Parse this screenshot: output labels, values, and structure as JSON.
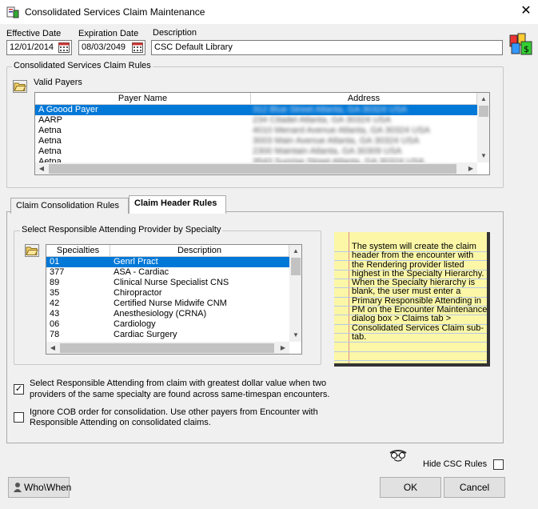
{
  "window": {
    "title": "Consolidated Services Claim Maintenance",
    "close_glyph": "✕"
  },
  "header": {
    "effective_date_label": "Effective Date",
    "effective_date": "12/01/2014",
    "expiration_date_label": "Expiration Date",
    "expiration_date": "08/03/2049",
    "description_label": "Description",
    "description": "CSC Default Library"
  },
  "rules_group": {
    "title": "Consolidated Services Claim Rules",
    "valid_payers_label": "Valid Payers",
    "columns": [
      "Payer Name",
      "Address"
    ],
    "rows": [
      [
        "A Goood Payer",
        "312 Blue Street Atlanta, GA 30324 USA"
      ],
      [
        "AARP",
        "234 Citadel Atlanta, GA 30324 USA"
      ],
      [
        "Aetna",
        "4010 Menard Avenue Atlanta, GA 30324 USA"
      ],
      [
        "Aetna",
        "3003 Main Avenue Atlanta, GA 30324 USA"
      ],
      [
        "Aetna",
        "2300 Maintain Atlanta, GA 30309 USA"
      ],
      [
        "Aetna",
        "3543 Sunrise Street Atlanta, GA 30324 USA"
      ]
    ]
  },
  "tabs": [
    {
      "label": "Claim Consolidation Rules"
    },
    {
      "label": "Claim Header Rules"
    }
  ],
  "specialty_group": {
    "title": "Select Responsible Attending Provider by Specialty",
    "columns": [
      "Specialties",
      "Description"
    ],
    "rows": [
      [
        "01",
        "Genrl Pract"
      ],
      [
        "377",
        "ASA - Cardiac"
      ],
      [
        "89",
        "Clinical Nurse Specialist CNS"
      ],
      [
        "35",
        "Chiropractor"
      ],
      [
        "42",
        "Certified Nurse Midwife CNM"
      ],
      [
        "43",
        "Anesthesiology (CRNA)"
      ],
      [
        "06",
        "Cardiology"
      ],
      [
        "78",
        "Cardiac Surgery"
      ]
    ]
  },
  "note_text": "The system will create the claim header from the encounter with the Rendering provider listed highest in the Specialty Hierarchy. When the Specialty hierarchy is blank, the user must enter a Primary Responsible Attending in PM on the Encounter Maintenance dialog box > Claims tab > Consolidated Services Claim sub-tab.",
  "options": {
    "greatest_dollar": {
      "checked": true,
      "line1": "Select Responsible Attending from claim with greatest dollar value when two",
      "line2": "providers of the same specialty are found across same-timespan encounters."
    },
    "ignore_cob": {
      "checked": false,
      "line1": "Ignore COB order for consolidation. Use other payers from Encounter with",
      "line2": "Responsible Attending on consolidated claims."
    }
  },
  "footer": {
    "hide_csc_label": "Hide CSC Rules",
    "hide_csc_checked": false,
    "who_when_label": "Who\\When",
    "ok_label": "OK",
    "cancel_label": "Cancel"
  },
  "colors": {
    "selection": "#0078d7",
    "note_bg": "#fbf7a6"
  }
}
